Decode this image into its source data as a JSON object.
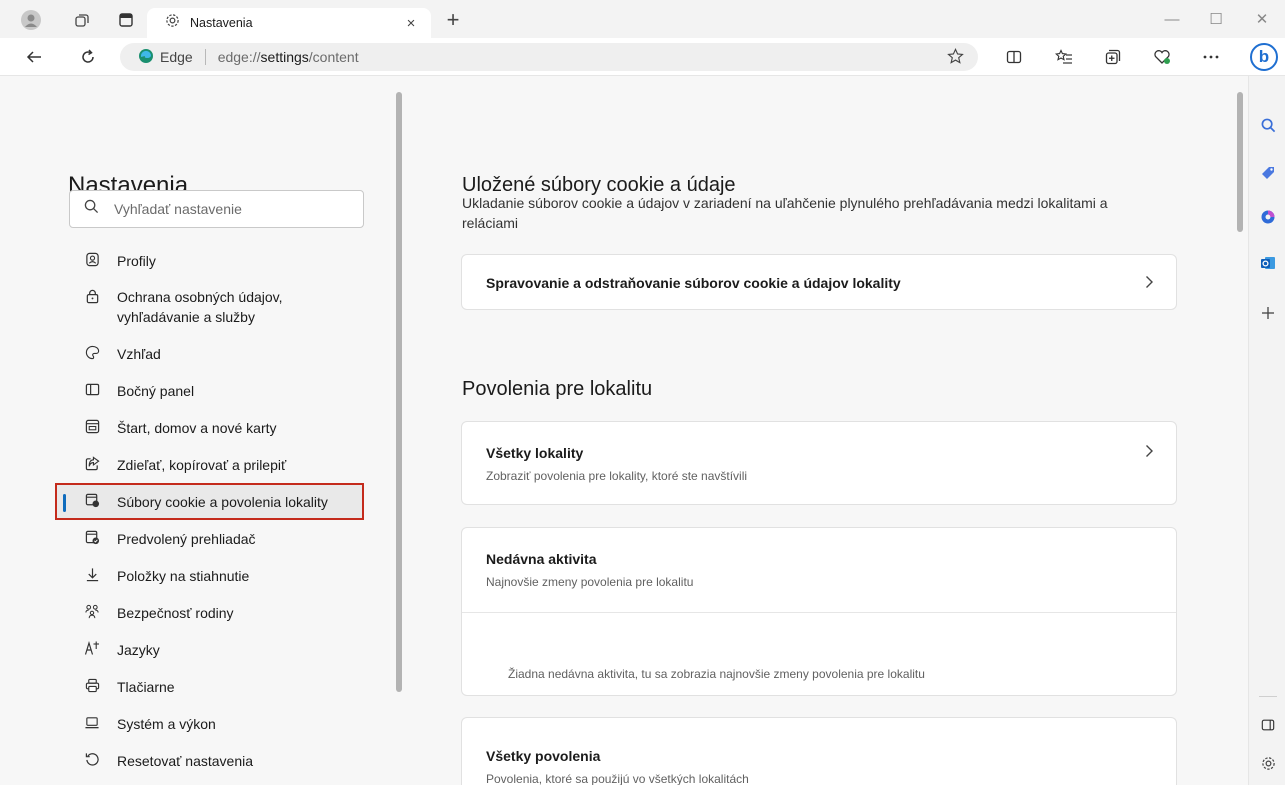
{
  "window": {
    "tab_title": "Nastavenia",
    "tab_close": "×",
    "new_tab": "+",
    "minimize": "—",
    "maximize": "☐",
    "close": "✕"
  },
  "addressbar": {
    "brand": "Edge",
    "url_prefix": "edge://",
    "url_host": "settings",
    "url_path": "/content"
  },
  "sidebar_nav": {
    "heading": "Nastavenia",
    "search_placeholder": "Vyhľadať nastavenie",
    "items": [
      {
        "label": "Profily",
        "icon": "profile-icon"
      },
      {
        "label": "Ochrana osobných údajov, vyhľadávanie a služby",
        "icon": "lock-icon"
      },
      {
        "label": "Vzhľad",
        "icon": "palette-icon"
      },
      {
        "label": "Bočný panel",
        "icon": "sidebar-icon"
      },
      {
        "label": "Štart, domov a nové karty",
        "icon": "home-icon"
      },
      {
        "label": "Zdieľať, kopírovať a prilepiť",
        "icon": "share-icon"
      },
      {
        "label": "Súbory cookie a povolenia lokality",
        "icon": "cookie-icon",
        "active": true
      },
      {
        "label": "Predvolený prehliadač",
        "icon": "browser-icon"
      },
      {
        "label": "Položky na stiahnutie",
        "icon": "download-icon"
      },
      {
        "label": "Bezpečnosť rodiny",
        "icon": "family-icon"
      },
      {
        "label": "Jazyky",
        "icon": "language-icon"
      },
      {
        "label": "Tlačiarne",
        "icon": "printer-icon"
      },
      {
        "label": "Systém a výkon",
        "icon": "laptop-icon"
      },
      {
        "label": "Resetovať nastavenia",
        "icon": "reset-icon"
      }
    ]
  },
  "main": {
    "cookies": {
      "title": "Uložené súbory cookie a údaje",
      "description": "Ukladanie súborov cookie a údajov v zariadení na uľahčenie plynulého prehľadávania medzi lokalitami a reláciami",
      "manage_label": "Spravovanie a odstraňovanie súborov cookie a údajov lokality"
    },
    "permissions": {
      "title": "Povolenia pre lokalitu",
      "all_sites_title": "Všetky lokality",
      "all_sites_sub": "Zobraziť povolenia pre lokality, ktoré ste navštívili",
      "recent_title": "Nedávna aktivita",
      "recent_sub": "Najnovšie zmeny povolenia pre lokalitu",
      "recent_empty": "Žiadna nedávna aktivita, tu sa zobrazia najnovšie zmeny povolenia pre lokalitu",
      "all_perms_title": "Všetky povolenia",
      "all_perms_sub": "Povolenia, ktoré sa použijú vo všetkých lokalitách"
    }
  },
  "colors": {
    "accent": "#0f6cbd",
    "highlight_border": "#c42b1c",
    "bing": "#1f6fd1"
  }
}
